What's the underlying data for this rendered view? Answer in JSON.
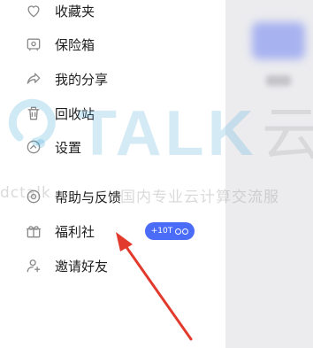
{
  "menu": {
    "items": [
      {
        "label": "收藏夹",
        "icon": "heart-icon"
      },
      {
        "label": "保险箱",
        "icon": "safe-icon"
      },
      {
        "label": "我的分享",
        "icon": "share-icon"
      },
      {
        "label": "回收站",
        "icon": "trash-icon"
      },
      {
        "label": "设置",
        "icon": "settings-icon"
      },
      {
        "label": "帮助与反馈",
        "icon": "help-icon"
      },
      {
        "label": "福利社",
        "icon": "gift-icon"
      },
      {
        "label": "邀请好友",
        "icon": "add-user-icon"
      }
    ],
    "welfare_badge": "+10T"
  },
  "watermark": {
    "logo_text": "TALK",
    "logo_glyph": "云",
    "line_left": "dctalk",
    "line_right": "国内专业云计算交流服"
  },
  "colors": {
    "badge": "#4a6cf7",
    "arrow": "#e23b2e",
    "icon": "#8a8a8a",
    "watermark": "#3fa6d9"
  }
}
